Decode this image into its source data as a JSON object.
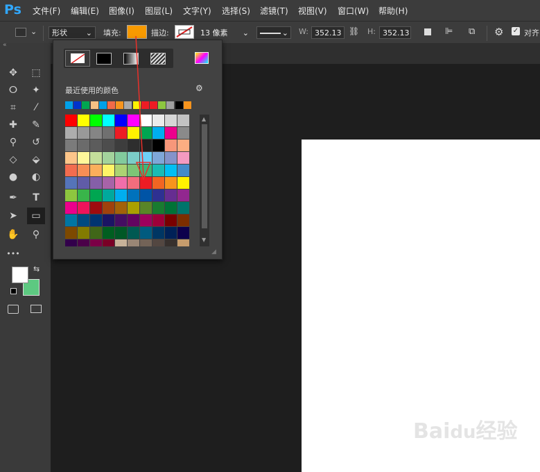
{
  "app": {
    "logo": "Ps",
    "brand_color": "#31a8ff"
  },
  "menu": [
    "文件(F)",
    "编辑(E)",
    "图像(I)",
    "图层(L)",
    "文字(Y)",
    "选择(S)",
    "滤镜(T)",
    "视图(V)",
    "窗口(W)",
    "帮助(H)"
  ],
  "options": {
    "mode_value": "形状",
    "fill_label": "填充:",
    "fill_color": "#f79a00",
    "stroke_label": "描边:",
    "stroke_width": "13 像素",
    "w_label": "W:",
    "w_value": "352.13 像",
    "h_label": "H:",
    "h_value": "352.13 像",
    "align_checkbox_label": "对齐"
  },
  "popup": {
    "recent_label": "最近使用的颜色",
    "recent_colors": [
      "#00a0e9",
      "#0033cc",
      "#00a651",
      "#f6c184",
      "#00a0e9",
      "#f26b48",
      "#f7941d",
      "#a8a8a8",
      "#fff200",
      "#ed1c24",
      "#ed1c24",
      "#8dc63f",
      "#a0a0a0",
      "#000000",
      "#f7941d"
    ],
    "swatch_rows": [
      [
        "#ff0000",
        "#ffff00",
        "#00ff00",
        "#00ffff",
        "#0000ff",
        "#ff00ff",
        "#ffffff",
        "#ebebeb",
        "#d6d6d6",
        "#c2c2c2"
      ],
      [
        "#adadad",
        "#999999",
        "#858585",
        "#707070",
        "#ed1c24",
        "#fff200",
        "#00a651",
        "#00aeef",
        "#ec008c",
        "#8a8a8a"
      ],
      [
        "#7b7b7b",
        "#6b6b6b",
        "#5c5c5c",
        "#4d4d4d",
        "#3d3d3d",
        "#2e2e2e",
        "#1f1f1f",
        "#000000",
        "#f7977a",
        "#fbad82"
      ],
      [
        "#fdc68a",
        "#fff79a",
        "#c4df9b",
        "#a3d39c",
        "#82ca9d",
        "#7bcdc8",
        "#6ecff6",
        "#7ea7d8",
        "#8493ca",
        "#f49ac1"
      ],
      [
        "#f26c4f",
        "#f68e55",
        "#fbaf5c",
        "#fff467",
        "#acd372",
        "#7cc576",
        "#3bb878",
        "#1abbb4",
        "#00bff3",
        "#438ccb"
      ],
      [
        "#5574b9",
        "#605ca8",
        "#855fa8",
        "#a763a8",
        "#f06eaa",
        "#f26d7d",
        "#ed1c24",
        "#f26522",
        "#f7941d",
        "#fff200"
      ],
      [
        "#8dc63f",
        "#39b54a",
        "#00a651",
        "#00a99d",
        "#00aeef",
        "#0072bc",
        "#0054a6",
        "#2e3192",
        "#662d91",
        "#92278f"
      ],
      [
        "#ec008c",
        "#ed145b",
        "#9e0b0f",
        "#a0410d",
        "#a36209",
        "#aba000",
        "#598527",
        "#197b30",
        "#007236",
        "#00746b"
      ],
      [
        "#0076a3",
        "#004a80",
        "#003471",
        "#1b1464",
        "#440e62",
        "#630460",
        "#9e005d",
        "#9e0039",
        "#790000",
        "#7b2e00"
      ],
      [
        "#7d4900",
        "#827b00",
        "#406618",
        "#005e20",
        "#005826",
        "#005952",
        "#005b7f",
        "#003663",
        "#002157",
        "#0d004c"
      ],
      [
        "#32004b",
        "#4b0049",
        "#7b0046",
        "#7a0026",
        "#c7b299",
        "#998675",
        "#736357",
        "#534741",
        "#37302d",
        "#c69c6d"
      ],
      [
        "#a67c52",
        "#8c6239",
        "#754c24",
        "#603913"
      ]
    ]
  },
  "toolbar": {
    "foreground_color": "#ffffff",
    "background_color": "#5dc981"
  },
  "icons": {
    "move": "✥",
    "marquee": "⬚",
    "lasso": "ⵔ",
    "magic": "✦",
    "crop": "⌗",
    "eyedropper": "⁄",
    "heal": "✚",
    "brush": "✎",
    "stamp": "⚲",
    "history": "↺",
    "eraser": "◇",
    "bucket": "⬙",
    "blur": "●",
    "dodge": "◐",
    "pen": "✒",
    "type": "T",
    "path": "➤",
    "rect": "▭",
    "hand": "✋",
    "zoom": "⚲",
    "more": "•••",
    "gear": "⚙"
  }
}
